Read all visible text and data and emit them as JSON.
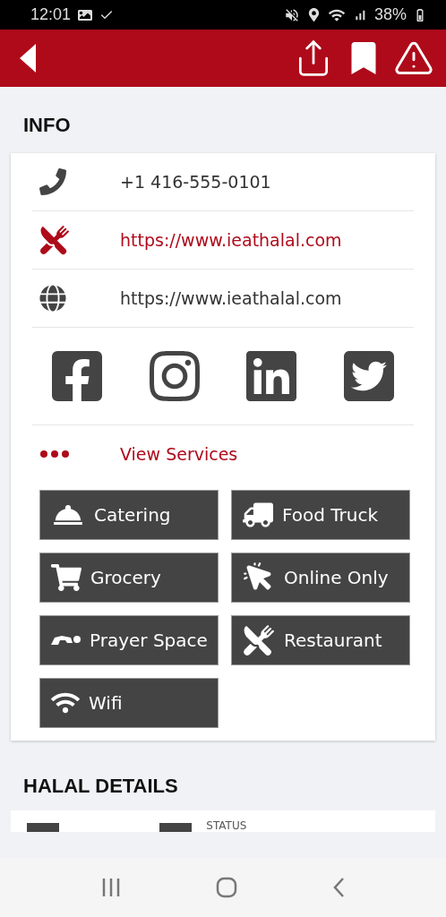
{
  "status_bar": {
    "time": "12:01",
    "battery": "38%"
  },
  "section_title": "INFO",
  "contacts": [
    {
      "kind": "phone",
      "text": "+1 416-555-0101"
    },
    {
      "kind": "menu",
      "text": "https://www.ieathalal.com"
    },
    {
      "kind": "web",
      "text": "https://www.ieathalal.com"
    }
  ],
  "socials": [
    {
      "kind": "facebook"
    },
    {
      "kind": "instagram"
    },
    {
      "kind": "linkedin"
    },
    {
      "kind": "twitter"
    }
  ],
  "view_services": "View Services",
  "services": [
    {
      "kind": "catering",
      "label": "Catering"
    },
    {
      "kind": "truck",
      "label": "Food Truck"
    },
    {
      "kind": "grocery",
      "label": "Grocery"
    },
    {
      "kind": "online",
      "label": "Online Only"
    },
    {
      "kind": "prayer",
      "label": "Prayer Space"
    },
    {
      "kind": "restaurant",
      "label": "Restaurant"
    },
    {
      "kind": "wifi",
      "label": "Wifi"
    }
  ],
  "halal_title": "HALAL DETAILS",
  "halal_status_label": "STATUS"
}
